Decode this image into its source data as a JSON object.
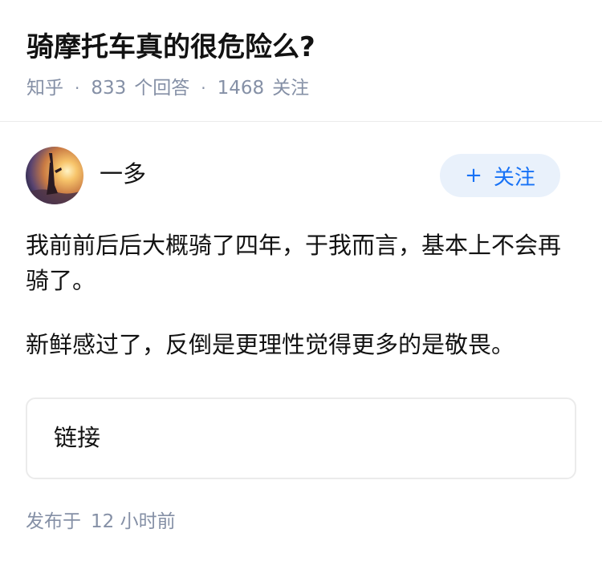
{
  "question": {
    "title": "骑摩托车真的很危险么?",
    "source": "知乎",
    "answers_count": "833",
    "answers_label": "个回答",
    "followers_count": "1468",
    "followers_label": "关注"
  },
  "author": {
    "name": "一多",
    "follow_label": "关注",
    "follow_icon": "plus-icon"
  },
  "answer": {
    "paragraphs": [
      "我前前后后大概骑了四年，于我而言，基本上不会再骑了。",
      "新鲜感过了，反倒是更理性觉得更多的是敬畏。"
    ],
    "link_label": "链接"
  },
  "footer": {
    "published_label": "发布于",
    "published_time": "12 小时前"
  },
  "colors": {
    "primary_blue": "#1772f6",
    "follow_bg": "#e9f1fb",
    "meta_gray": "#8590a6",
    "divider": "#ebebeb"
  }
}
